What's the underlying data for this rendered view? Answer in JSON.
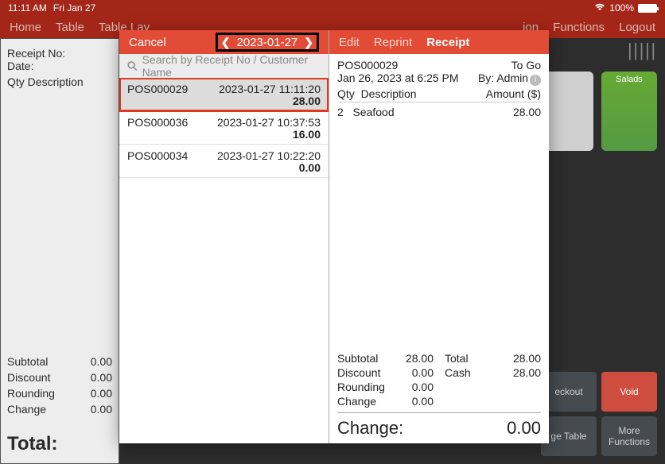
{
  "status": {
    "time": "11:11 AM",
    "date": "Fri Jan 27",
    "battery": "100%"
  },
  "nav": {
    "home": "Home",
    "table": "Table",
    "tablelay": "Table Lay",
    "ion": "ion",
    "functions": "Functions",
    "logout": "Logout"
  },
  "bg_receipt": {
    "receipt_no_label": "Receipt No:",
    "date_label": "Date:",
    "qty_desc": "Qty  Description",
    "subtotal_l": "Subtotal",
    "subtotal_v": "0.00",
    "discount_l": "Discount",
    "discount_v": "0.00",
    "rounding_l": "Rounding",
    "rounding_v": "0.00",
    "change_l": "Change",
    "change_v": "0.00",
    "total_l": "Total:"
  },
  "catalog": {
    "salads": "Salads"
  },
  "bg_buttons": {
    "checkout": "eckout",
    "void": "Void",
    "table": "ge Table",
    "more": "More Functions"
  },
  "popup": {
    "cancel": "Cancel",
    "date": "2023-01-27",
    "search_placeholder": "Search by Receipt No / Customer Name",
    "receipts": [
      {
        "id": "POS000029",
        "ts": "2023-01-27 11:11:20",
        "amt": "28.00",
        "selected": true
      },
      {
        "id": "POS000036",
        "ts": "2023-01-27 10:37:53",
        "amt": "16.00",
        "selected": false
      },
      {
        "id": "POS000034",
        "ts": "2023-01-27 10:22:20",
        "amt": "0.00",
        "selected": false
      }
    ],
    "tabs": {
      "edit": "Edit",
      "reprint": "Reprint",
      "receipt": "Receipt"
    },
    "detail": {
      "id": "POS000029",
      "status": "To Go",
      "dt": "Jan 26, 2023 at 6:25 PM",
      "by": "By: Admin",
      "qty_l": "Qty",
      "desc_l": "Description",
      "amt_l": "Amount ($)",
      "line_qty": "2",
      "line_desc": "Seafood",
      "line_amt": "28.00",
      "subtotal_l": "Subtotal",
      "subtotal_v": "28.00",
      "discount_l": "Discount",
      "discount_v": "0.00",
      "rounding_l": "Rounding",
      "rounding_v": "0.00",
      "change_l": "Change",
      "change_v": "0.00",
      "total_l": "Total",
      "total_v": "28.00",
      "cash_l": "Cash",
      "cash_v": "28.00",
      "big_change_l": "Change:",
      "big_change_v": "0.00"
    }
  }
}
